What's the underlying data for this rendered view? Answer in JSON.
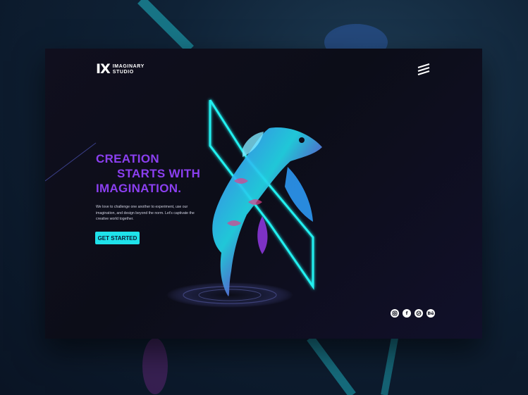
{
  "brand": {
    "mark": "IX",
    "name_line1": "IMAGINARY",
    "name_line2": "STUDIO"
  },
  "nav": {
    "menu_icon": "hamburger-menu-icon"
  },
  "hero": {
    "headline_line1": "CREATION",
    "headline_line2": "STARTS WITH",
    "headline_line3": "IMAGINATION.",
    "body": "We love to challenge one another to experiment, use our imagination, and design beyond the norm. Let's captivate the creative world together.",
    "cta_label": "GET STARTED"
  },
  "social": {
    "icons": [
      "instagram-icon",
      "facebook-icon",
      "dribbble-icon",
      "behance-icon"
    ],
    "facebook_glyph": "f",
    "behance_glyph": "Bē"
  },
  "colors": {
    "headline": "#8b3ff0",
    "accent": "#1fe2ea",
    "card_bg": "#0e0e1c"
  }
}
